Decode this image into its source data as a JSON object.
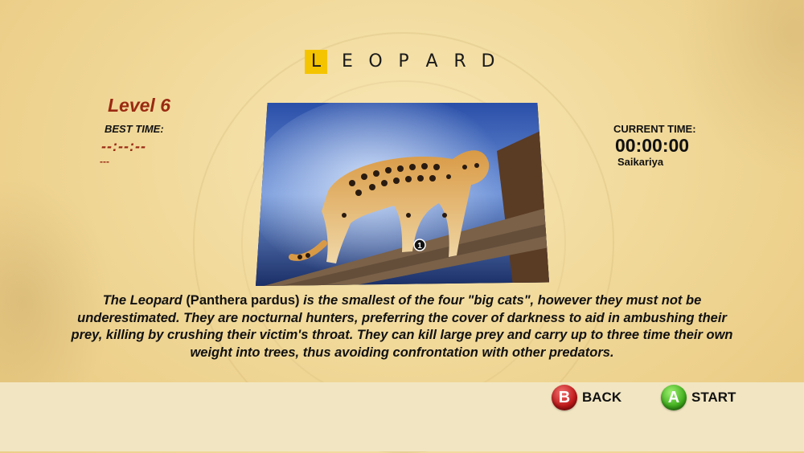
{
  "title": {
    "highlight_letter": "L",
    "rest_letters": [
      "E",
      "O",
      "P",
      "A",
      "R",
      "D"
    ],
    "highlight_color": "#f5c400"
  },
  "stats": {
    "level": "Level 6",
    "best_time_label": "BEST TIME:",
    "best_time_value": "--:--:--",
    "best_time_player": "---",
    "current_time_label": "CURRENT TIME:",
    "current_time_value": "00:00:00",
    "current_player": "Saikariya"
  },
  "puzzle": {
    "image_subject": "leopard",
    "piece_marker": "1"
  },
  "description": {
    "name_part": "The Leopard ",
    "latin_part": "(Panthera pardus)",
    "text_part": " is the smallest of the four \"big cats\", however they must not be underestimated. They are nocturnal hunters, preferring the cover of darkness to aid in ambushing their prey, killing by crushing their victim's throat. They can kill large prey and carry up to three time their own weight into trees, thus avoiding confrontation with other predators."
  },
  "buttons": {
    "back": {
      "key": "B",
      "label": "BACK",
      "color": "#c01818"
    },
    "start": {
      "key": "A",
      "label": "START",
      "color": "#3fae1c"
    }
  },
  "colors": {
    "accent_text": "#9a2a12",
    "background": "#f1d99a"
  }
}
